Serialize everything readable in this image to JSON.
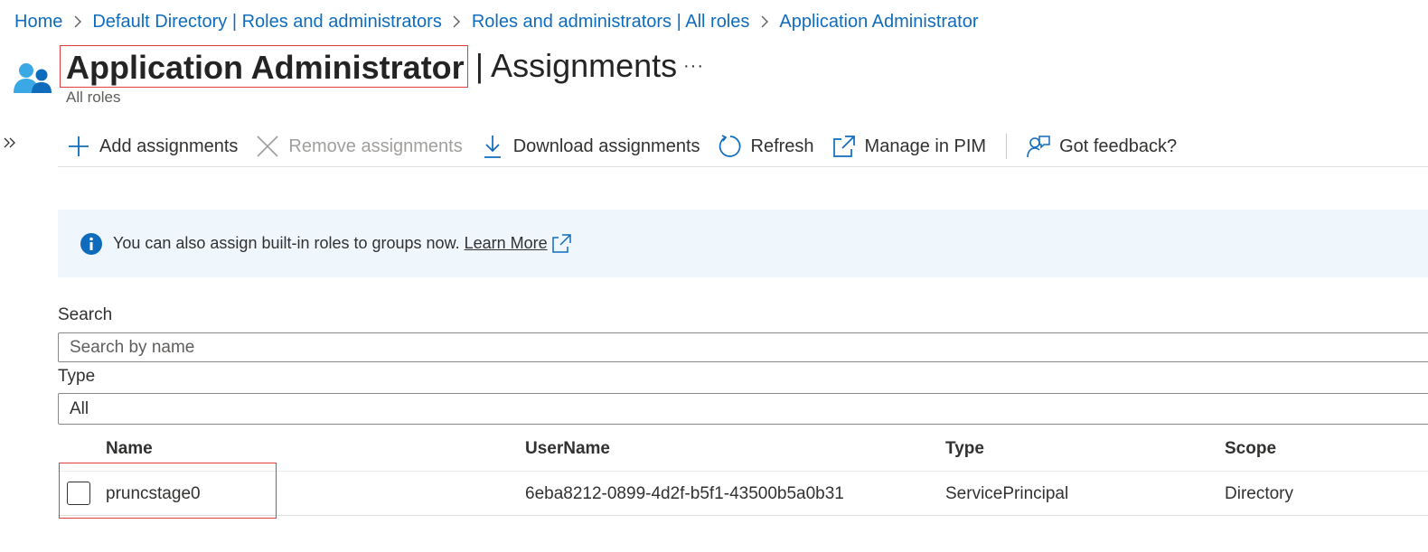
{
  "breadcrumb": [
    {
      "label": "Home"
    },
    {
      "label": "Default Directory | Roles and administrators"
    },
    {
      "label": "Roles and administrators | All roles"
    },
    {
      "label": "Application Administrator"
    }
  ],
  "header": {
    "title": "Application Administrator",
    "subtitle_suffix": "| Assignments",
    "more_label": "···",
    "breadcrumb_caption": "All roles"
  },
  "toolbar": {
    "add": "Add assignments",
    "remove": "Remove assignments",
    "download": "Download assignments",
    "refresh": "Refresh",
    "manage_pim": "Manage in PIM",
    "feedback": "Got feedback?"
  },
  "banner": {
    "text": "You can also assign built-in roles to groups now.",
    "link": "Learn More"
  },
  "filters": {
    "search_label": "Search",
    "search_placeholder": "Search by name",
    "type_label": "Type",
    "type_value": "All"
  },
  "table": {
    "columns": [
      "Name",
      "UserName",
      "Type",
      "Scope"
    ],
    "rows": [
      {
        "name": "pruncstage0",
        "username": "6eba8212-0899-4d2f-b5f1-43500b5a0b31",
        "type": "ServicePrincipal",
        "scope": "Directory"
      }
    ]
  },
  "colors": {
    "link": "#0f6cbd",
    "banner_bg": "#eff6fc",
    "highlight": "#e03e3e"
  }
}
